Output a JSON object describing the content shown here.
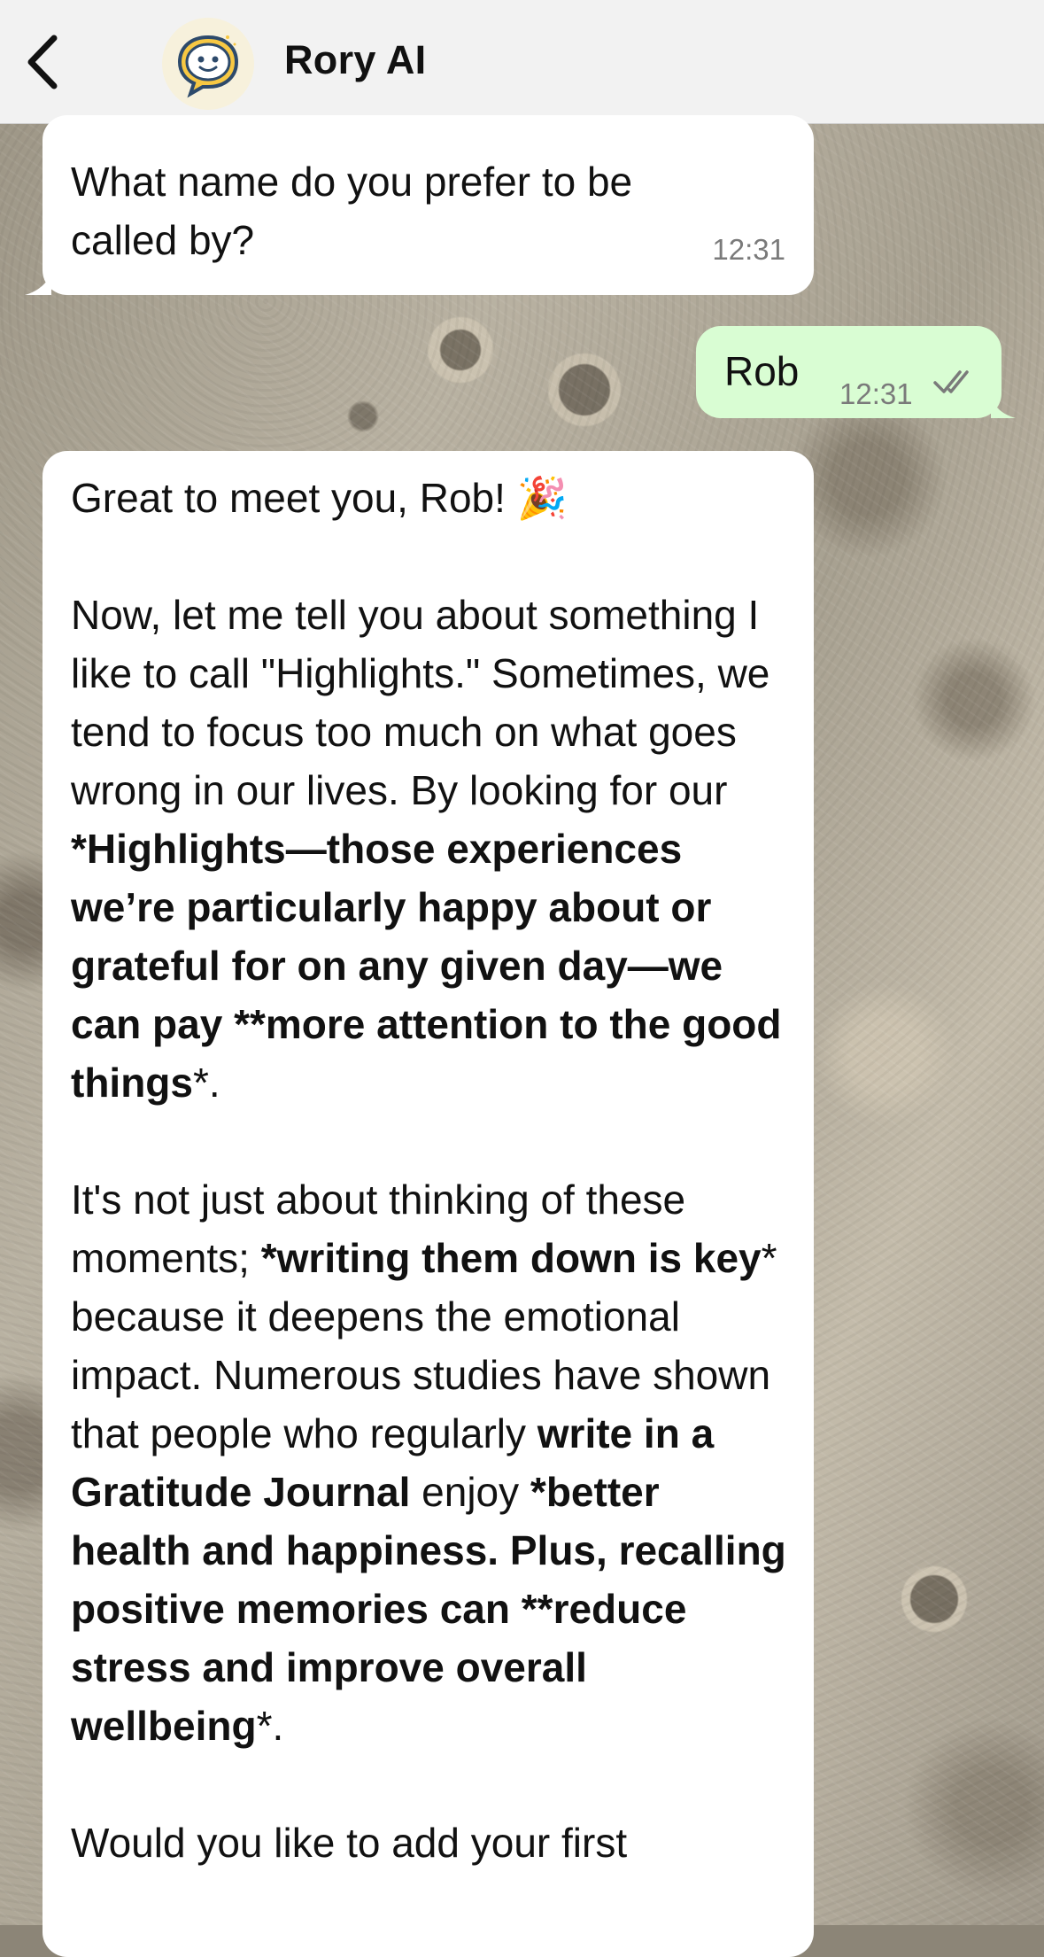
{
  "header": {
    "title": "Rory AI",
    "back_icon": "chevron-left-icon",
    "avatar_icon": "smiling-chat-bubble-icon"
  },
  "messages": [
    {
      "direction": "incoming",
      "text": "What name do you prefer to be called by?",
      "time": "12:31"
    },
    {
      "direction": "outgoing",
      "text": "Rob",
      "time": "12:31",
      "status_icon": "double-check-icon"
    },
    {
      "direction": "incoming",
      "greeting": "Great to meet you, Rob! 🎉",
      "p1_a": "Now, let me tell you about something I like to call \"Highlights.\" Sometimes, we tend to focus too much on what goes wrong in our lives. By looking for our ",
      "p1_b": "*Highlights—those experiences we’re particularly happy about or grateful for on any given day—we can pay **more attention to the good things",
      "p1_c": "*.",
      "p2_a": "It's not just about thinking of these moments; ",
      "p2_b": "*writing them down is key",
      "p2_c": "* because it deepens the emotional impact. Numerous studies have shown that people who regularly ",
      "p2_d": "write in a Gratitude Journal",
      "p2_e": " enjoy ",
      "p2_f": "*better health and happiness. Plus, recalling positive memories can **reduce stress and improve overall wellbeing",
      "p2_g": "*.",
      "p3": "Would you like to add your first"
    }
  ],
  "colors": {
    "incoming_bubble": "#ffffff",
    "outgoing_bubble": "#d9fdd3",
    "header_bg": "#f2f2f2"
  }
}
